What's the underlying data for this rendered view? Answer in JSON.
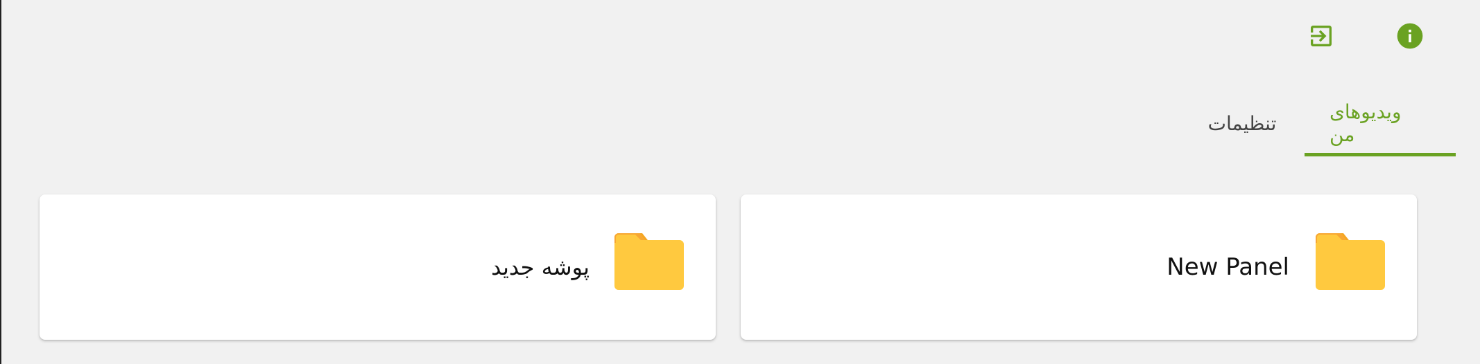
{
  "header": {
    "info_icon": "info-icon",
    "exit_icon": "login-icon",
    "accent_color": "#6aa222"
  },
  "tabs": [
    {
      "label": "ویدیوهای من",
      "active": true
    },
    {
      "label": "تنظیمات",
      "active": false
    }
  ],
  "folders": [
    {
      "name": "New Panel",
      "icon": "folder-icon",
      "color": "#ffc93f"
    },
    {
      "name": "پوشه جدید",
      "icon": "folder-icon",
      "color": "#ffc93f"
    }
  ]
}
